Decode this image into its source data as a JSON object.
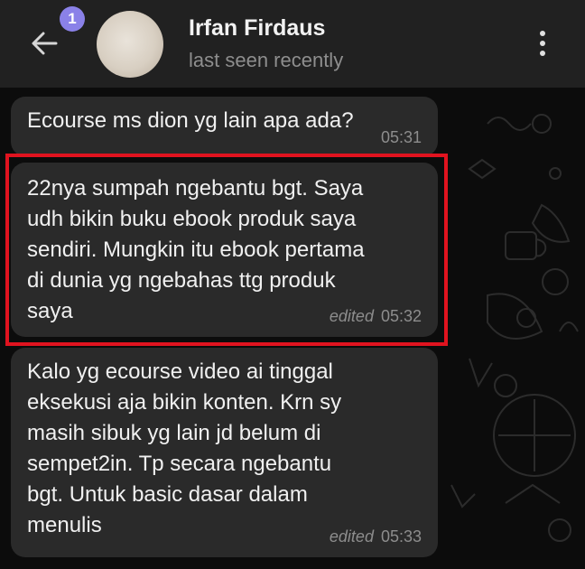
{
  "header": {
    "unread_badge": "1",
    "contact_name": "Irfan Firdaus",
    "status": "last seen recently",
    "back_icon": "arrow-left-icon",
    "menu_icon": "more-vertical-icon"
  },
  "messages": [
    {
      "text": "Ecourse ms dion yg lain apa ada?",
      "edited": "",
      "time": "05:31"
    },
    {
      "text": "22nya sumpah ngebantu bgt. Saya\nudh bikin buku ebook produk saya\nsendiri. Mungkin itu ebook pertama\ndi dunia yg ngebahas ttg produk\nsaya",
      "edited": "edited",
      "time": "05:32"
    },
    {
      "text": "Kalo yg ecourse video ai tinggal\neksekusi aja bikin konten. Krn sy\nmasih sibuk yg lain jd belum di\nsempet2in. Tp secara ngebantu\nbgt. Untuk basic dasar dalam\nmenulis",
      "edited": "edited",
      "time": "05:33"
    }
  ],
  "colors": {
    "header_bg": "#212121",
    "bubble_bg": "#2a2a2a",
    "badge_bg": "#8a81e8",
    "highlight": "#e0131f"
  }
}
